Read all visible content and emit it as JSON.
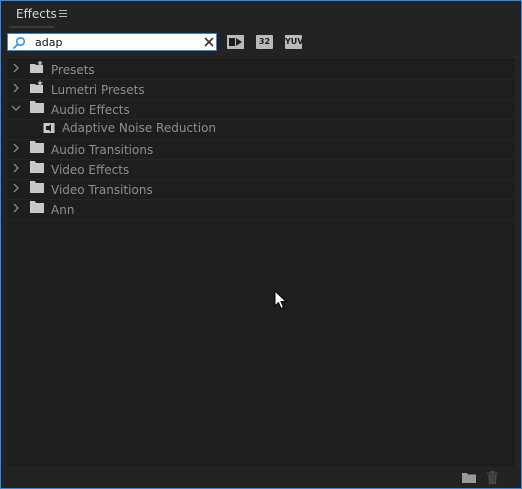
{
  "panel": {
    "title": "Effects"
  },
  "search": {
    "value": "adap"
  },
  "filters": {
    "accelerated_label": "",
    "bit32_label": "32",
    "yuv_label": "YUV"
  },
  "tree": {
    "items": [
      {
        "label": "Presets",
        "icon": "preset-folder-icon",
        "expanded": false
      },
      {
        "label": "Lumetri Presets",
        "icon": "preset-folder-icon",
        "expanded": false
      },
      {
        "label": "Audio Effects",
        "icon": "folder-icon",
        "expanded": true
      },
      {
        "label": "Adaptive Noise Reduction",
        "icon": "audio-effect-icon",
        "child": true
      },
      {
        "label": "Audio Transitions",
        "icon": "folder-icon",
        "expanded": false
      },
      {
        "label": "Video Effects",
        "icon": "folder-icon",
        "expanded": false
      },
      {
        "label": "Video Transitions",
        "icon": "folder-icon",
        "expanded": false
      },
      {
        "label": "Ann",
        "icon": "folder-icon",
        "expanded": false
      }
    ]
  },
  "colors": {
    "accent": "#2d8ceb",
    "background": "#232323",
    "text": "#8e8e8e"
  }
}
